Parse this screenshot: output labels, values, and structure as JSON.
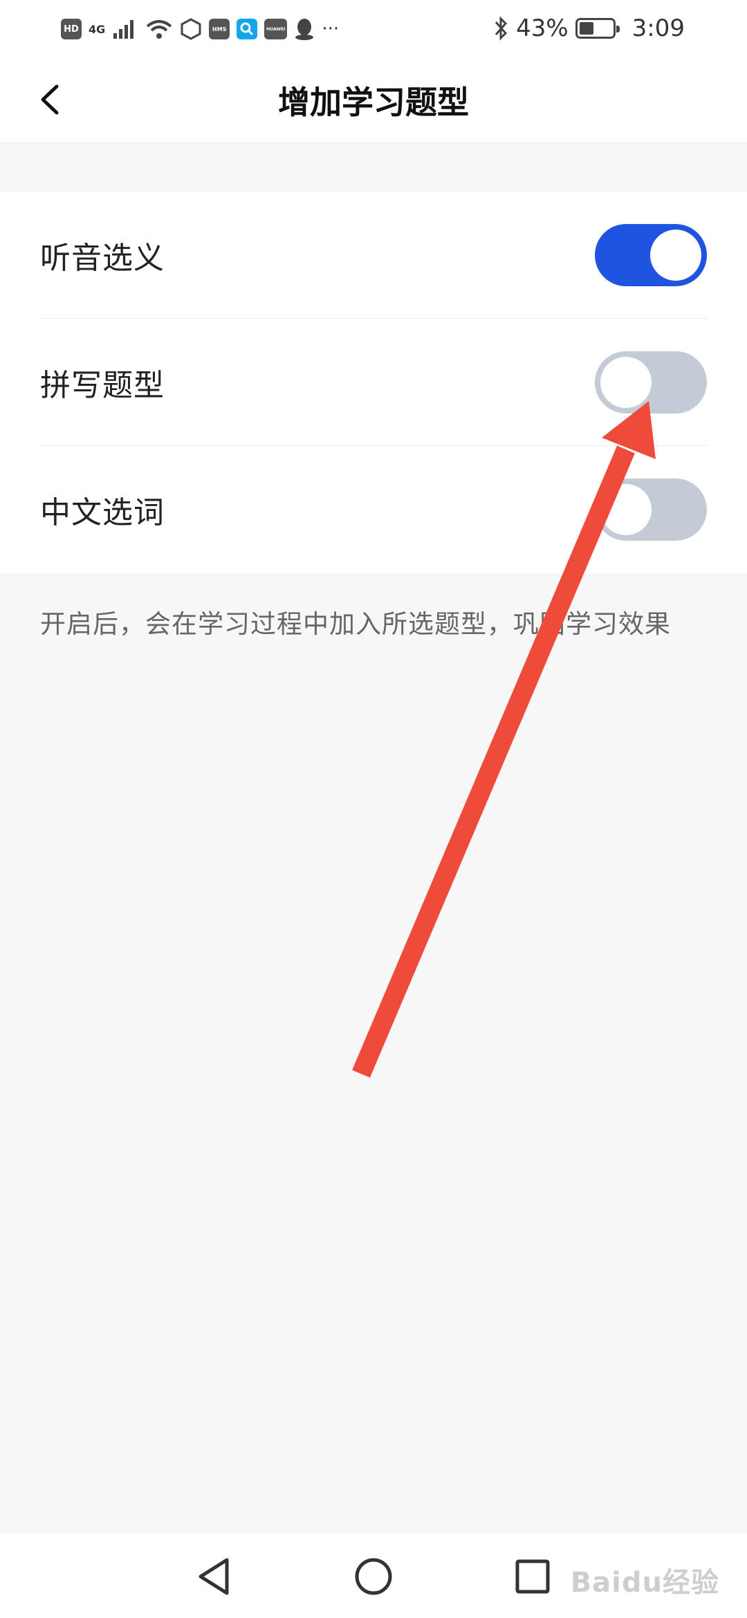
{
  "status_bar": {
    "hd": "HD",
    "network": "4G",
    "hms": "HMS",
    "huawei": "HUAWEI",
    "more": "···",
    "battery_percent": "43%",
    "battery_level": 0.43,
    "time": "3:09"
  },
  "header": {
    "title": "增加学习题型"
  },
  "settings": [
    {
      "label": "听音选义",
      "enabled": true
    },
    {
      "label": "拼写题型",
      "enabled": false
    },
    {
      "label": "中文选词",
      "enabled": false
    }
  ],
  "hint": "开启后，会在学习过程中加入所选题型，巩固学习效果",
  "watermark": "Baidu经验",
  "colors": {
    "toggle_on": "#1f54e0",
    "toggle_off": "#c3cbd6",
    "annotation_arrow": "#ef4b3b"
  },
  "icons": {
    "back": "chevron-left-icon",
    "nav_back": "triangle-back-icon",
    "nav_home": "circle-home-icon",
    "nav_recent": "square-recent-icon"
  }
}
